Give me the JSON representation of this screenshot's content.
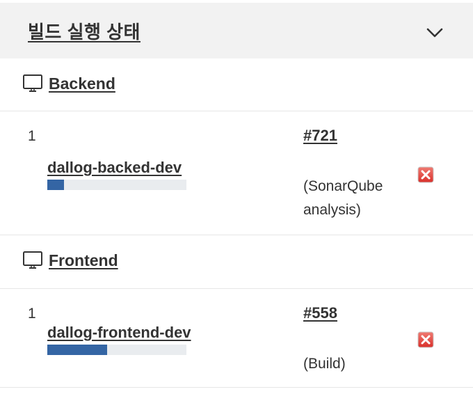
{
  "header": {
    "title": "빌드 실행 상태",
    "toggle_icon": "chevron-down-icon"
  },
  "groups": [
    {
      "name": "Backend",
      "icon": "monitor-icon",
      "jobs": [
        {
          "index": "1",
          "name": "dallog-backed-dev",
          "progress": 0.12,
          "build": "#721",
          "stage": "(SonarQube analysis)",
          "stop_icon": "stop-icon"
        }
      ]
    },
    {
      "name": "Frontend",
      "icon": "monitor-icon",
      "jobs": [
        {
          "index": "1",
          "name": "dallog-frontend-dev",
          "progress": 0.43,
          "build": "#558",
          "stage": "(Build)",
          "stop_icon": "stop-icon"
        }
      ]
    }
  ],
  "colors": {
    "header_bg": "#f2f2f2",
    "progress_fill": "#3465a4",
    "progress_track": "#e9ecef",
    "stop_red": "#e8413b"
  }
}
